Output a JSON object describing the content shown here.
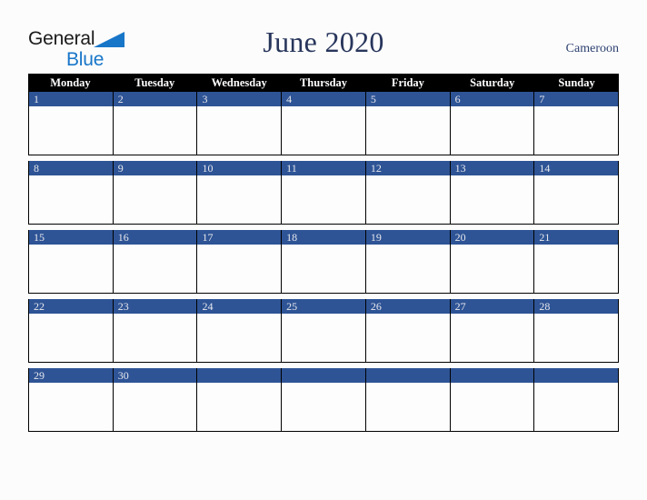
{
  "brand": {
    "word1": "General",
    "word2": "Blue",
    "triangle_color": "#1876c8",
    "word1_color": "#1b1b1b"
  },
  "header": {
    "title": "June 2020",
    "country": "Cameroon",
    "title_color": "#28365c",
    "country_color": "#2e4272"
  },
  "calendar": {
    "day_header_bg": "#000000",
    "day_header_color": "#ffffff",
    "day_bar_color": "#2e5496",
    "day_number_color": "#e8e8ec",
    "weekdays": [
      "Monday",
      "Tuesday",
      "Wednesday",
      "Thursday",
      "Friday",
      "Saturday",
      "Sunday"
    ],
    "weeks": [
      [
        "1",
        "2",
        "3",
        "4",
        "5",
        "6",
        "7"
      ],
      [
        "8",
        "9",
        "10",
        "11",
        "12",
        "13",
        "14"
      ],
      [
        "15",
        "16",
        "17",
        "18",
        "19",
        "20",
        "21"
      ],
      [
        "22",
        "23",
        "24",
        "25",
        "26",
        "27",
        "28"
      ],
      [
        "29",
        "30",
        "",
        "",
        "",
        "",
        ""
      ]
    ]
  }
}
